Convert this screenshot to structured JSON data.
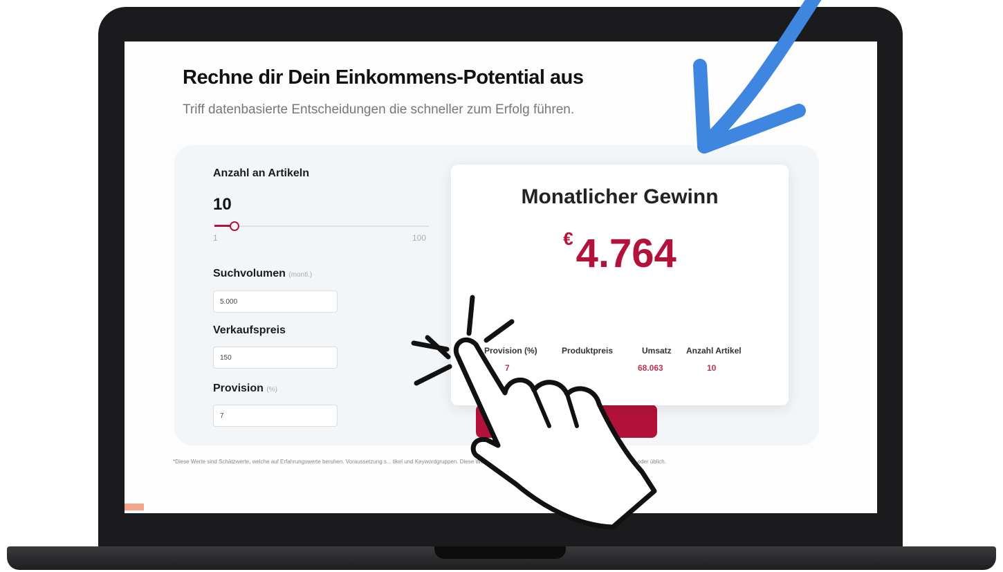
{
  "calculator": {
    "title": "Rechne dir Dein Einkommens-Potential aus",
    "subtitle": "Triff datenbasierte Entscheidungen die  schneller zum Erfolg führen.",
    "articles_slider": {
      "label": "Anzahl an Artikeln",
      "value": "10",
      "min": "1",
      "max": "100"
    },
    "search_volume": {
      "label": "Suchvolumen",
      "hint": "(montl.)",
      "value": "5.000"
    },
    "sale_price": {
      "label": "Verkaufspreis",
      "value": "150"
    },
    "commission": {
      "label": "Provision",
      "hint": "(%)",
      "value": "7"
    },
    "result": {
      "title": "Monatlicher Gewinn",
      "currency": "€",
      "amount": "4.764",
      "stats": [
        {
          "label": "Provision (%)",
          "value": "7"
        },
        {
          "label": "Produktpreis",
          "value": ""
        },
        {
          "label": "Umsatz",
          "value": "68.063"
        },
        {
          "label": "Anzahl Artikel",
          "value": "10"
        }
      ]
    },
    "disclaimer": "*Diese Werte sind Schätzwerte, welche auf Erfahrungswerte beruhen. Voraussetzung s... tikel und Keywordgruppen. Diese Werte sind ohne eine gemeinsame Zusammenarbeit nicht typisch oder üblich."
  },
  "colors": {
    "accent": "#b3123a",
    "arrow": "#3f86e0",
    "bezel": "#1b1b1d"
  },
  "icons": {
    "arrow_overlay": "arrow-down-left-icon",
    "hand_overlay": "pointing-hand-icon"
  }
}
